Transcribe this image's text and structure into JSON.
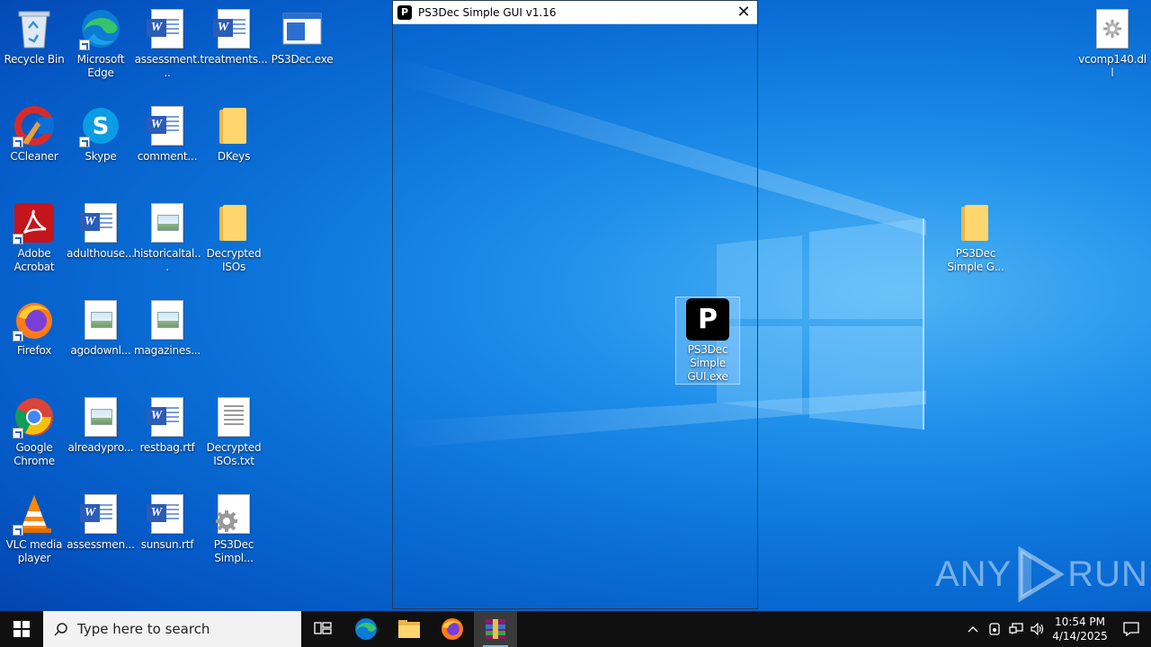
{
  "desktop": {
    "icons": [
      {
        "label": "Recycle Bin",
        "kind": "recycle-bin"
      },
      {
        "label": "Microsoft Edge",
        "kind": "edge"
      },
      {
        "label": "assessment...",
        "kind": "word"
      },
      {
        "label": "treatments...",
        "kind": "word"
      },
      {
        "label": "PS3Dec.exe",
        "kind": "exe"
      },
      {
        "label": "CCleaner",
        "kind": "ccleaner"
      },
      {
        "label": "Skype",
        "kind": "skype"
      },
      {
        "label": "comment...",
        "kind": "word"
      },
      {
        "label": "DKeys",
        "kind": "folder"
      },
      {
        "label": "Adobe Acrobat",
        "kind": "acrobat"
      },
      {
        "label": "adulthouse...",
        "kind": "word"
      },
      {
        "label": "historicaltal...",
        "kind": "image"
      },
      {
        "label": "Decrypted ISOs",
        "kind": "folder"
      },
      {
        "label": "Firefox",
        "kind": "firefox"
      },
      {
        "label": "agodownl...",
        "kind": "image"
      },
      {
        "label": "magazines...",
        "kind": "image"
      },
      {
        "label": "Google Chrome",
        "kind": "chrome"
      },
      {
        "label": "alreadypro...",
        "kind": "image"
      },
      {
        "label": "restbag.rtf",
        "kind": "word"
      },
      {
        "label": "Decrypted ISOs.txt",
        "kind": "text"
      },
      {
        "label": "VLC media player",
        "kind": "vlc"
      },
      {
        "label": "assessmen...",
        "kind": "word"
      },
      {
        "label": "sunsun.rtf",
        "kind": "word"
      },
      {
        "label": "PS3Dec Simpl...",
        "kind": "settings-file"
      },
      {
        "label": "vcomp140.dll",
        "kind": "dll"
      },
      {
        "label": "PS3Dec Simple G...",
        "kind": "folder"
      }
    ],
    "selected_icon": {
      "label": "PS3Dec Simple GUI.exe",
      "glyph": "P"
    }
  },
  "window": {
    "title": "PS3Dec Simple GUI v1.16",
    "app_glyph": "P",
    "close_glyph": "✕"
  },
  "watermark": {
    "left": "ANY",
    "right": "RUN"
  },
  "taskbar": {
    "search_placeholder": "Type here to search",
    "time": "10:54 PM",
    "date": "4/14/2025"
  },
  "colors": {
    "desktop_bg": "#0a6fd6",
    "taskbar_bg": "#101010",
    "word_blue": "#2b5cb8",
    "folder_yellow": "#ffd56e"
  }
}
